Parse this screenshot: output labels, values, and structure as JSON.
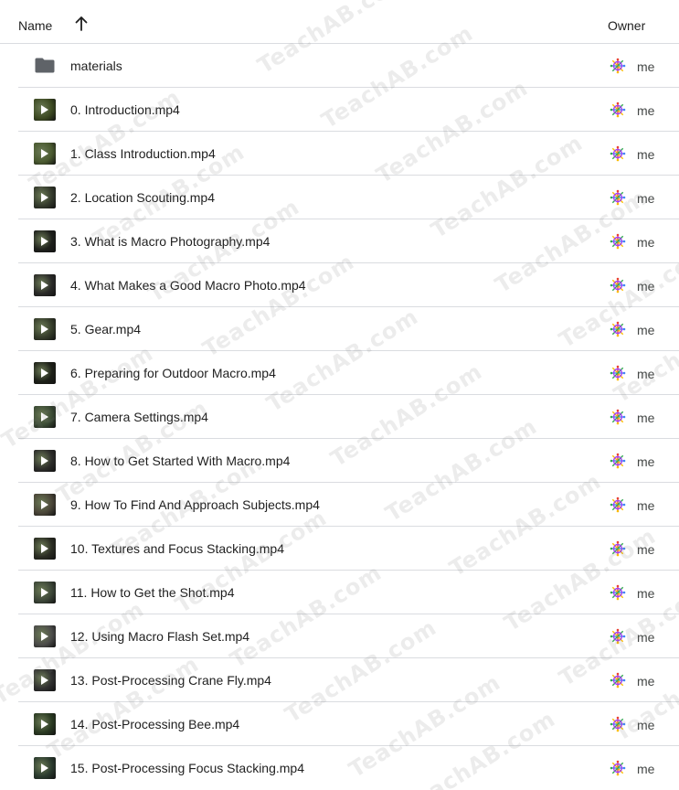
{
  "header": {
    "name_label": "Name",
    "owner_label": "Owner",
    "sort_icon": "arrow-up-icon"
  },
  "colors": {
    "folder": "#5f6368",
    "divider": "#dadce0",
    "thumbnails": [
      "#2a3a2e",
      "#3d4a22",
      "#4a5a30",
      "#343a2c",
      "#1e201c",
      "#2a2a28",
      "#353c2a",
      "#1d2018",
      "#3a4a34",
      "#2c2c2a",
      "#4a4538",
      "#2a2c22",
      "#3c4638",
      "#4c4c4a",
      "#303030",
      "#2a3a22"
    ]
  },
  "watermark": "TeachAB.com",
  "files": [
    {
      "name": "materials",
      "type": "folder",
      "owner": "me"
    },
    {
      "name": "0. Introduction.mp4",
      "type": "video",
      "owner": "me"
    },
    {
      "name": "1. Class Introduction.mp4",
      "type": "video",
      "owner": "me"
    },
    {
      "name": "2. Location Scouting.mp4",
      "type": "video",
      "owner": "me"
    },
    {
      "name": "3. What is Macro Photography.mp4",
      "type": "video",
      "owner": "me"
    },
    {
      "name": "4. What Makes a Good Macro Photo.mp4",
      "type": "video",
      "owner": "me"
    },
    {
      "name": "5. Gear.mp4",
      "type": "video",
      "owner": "me"
    },
    {
      "name": "6. Preparing for Outdoor Macro.mp4",
      "type": "video",
      "owner": "me"
    },
    {
      "name": "7. Camera Settings.mp4",
      "type": "video",
      "owner": "me"
    },
    {
      "name": "8. How to Get Started With Macro.mp4",
      "type": "video",
      "owner": "me"
    },
    {
      "name": "9. How To Find And Approach Subjects.mp4",
      "type": "video",
      "owner": "me"
    },
    {
      "name": "10. Textures and Focus Stacking.mp4",
      "type": "video",
      "owner": "me"
    },
    {
      "name": "11. How to Get the Shot.mp4",
      "type": "video",
      "owner": "me"
    },
    {
      "name": "12. Using Macro Flash Set.mp4",
      "type": "video",
      "owner": "me"
    },
    {
      "name": "13. Post-Processing Crane Fly.mp4",
      "type": "video",
      "owner": "me"
    },
    {
      "name": "14. Post-Processing Bee.mp4",
      "type": "video",
      "owner": "me"
    },
    {
      "name": "15. Post-Processing Focus Stacking.mp4",
      "type": "video",
      "owner": "me"
    }
  ]
}
